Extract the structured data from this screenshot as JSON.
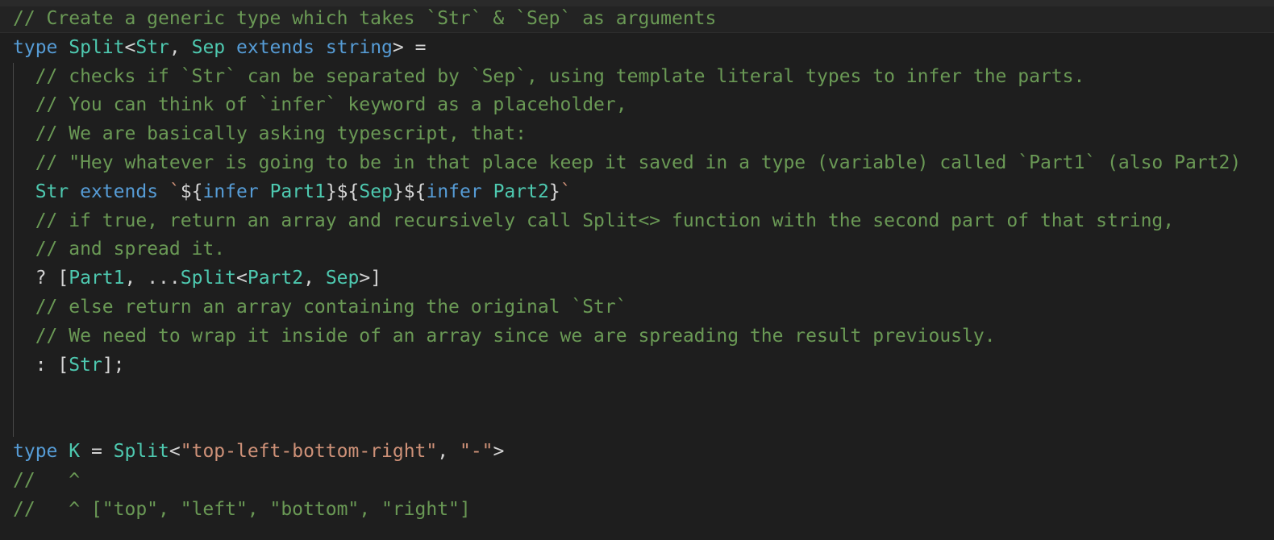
{
  "editor": {
    "language": "typescript",
    "theme": {
      "background": "#1e1e1e",
      "comment": "#6a9955",
      "keyword": "#569cd6",
      "type": "#4ec9b0",
      "string": "#ce9178",
      "text": "#d4d4d4"
    },
    "lines": [
      [
        {
          "t": "// Create a generic type which takes `Str` & `Sep` as arguments",
          "k": "c"
        }
      ],
      [
        {
          "t": "type",
          "k": "kw"
        },
        {
          "t": " ",
          "k": "pn"
        },
        {
          "t": "Split",
          "k": "ty"
        },
        {
          "t": "<",
          "k": "pn"
        },
        {
          "t": "Str",
          "k": "ty"
        },
        {
          "t": ", ",
          "k": "pn"
        },
        {
          "t": "Sep",
          "k": "ty"
        },
        {
          "t": " ",
          "k": "pn"
        },
        {
          "t": "extends",
          "k": "kw"
        },
        {
          "t": " ",
          "k": "pn"
        },
        {
          "t": "string",
          "k": "kw"
        },
        {
          "t": "> =",
          "k": "pn"
        }
      ],
      [
        {
          "t": "  // checks if `Str` can be separated by `Sep`, using template literal types to infer the parts.",
          "k": "c"
        }
      ],
      [
        {
          "t": "  // You can think of `infer` keyword as a placeholder,",
          "k": "c"
        }
      ],
      [
        {
          "t": "  // We are basically asking typescript, that:",
          "k": "c"
        }
      ],
      [
        {
          "t": "  // \"Hey whatever is going to be in that place keep it saved in a type (variable) called `Part1` (also Part2)",
          "k": "c"
        }
      ],
      [
        {
          "t": "  ",
          "k": "pn"
        },
        {
          "t": "Str",
          "k": "ty"
        },
        {
          "t": " ",
          "k": "pn"
        },
        {
          "t": "extends",
          "k": "kw"
        },
        {
          "t": " ",
          "k": "pn"
        },
        {
          "t": "`",
          "k": "tick"
        },
        {
          "t": "${",
          "k": "pn"
        },
        {
          "t": "infer",
          "k": "kw"
        },
        {
          "t": " ",
          "k": "pn"
        },
        {
          "t": "Part1",
          "k": "ty"
        },
        {
          "t": "}${",
          "k": "pn"
        },
        {
          "t": "Sep",
          "k": "ty"
        },
        {
          "t": "}${",
          "k": "pn"
        },
        {
          "t": "infer",
          "k": "kw"
        },
        {
          "t": " ",
          "k": "pn"
        },
        {
          "t": "Part2",
          "k": "ty"
        },
        {
          "t": "}",
          "k": "pn"
        },
        {
          "t": "`",
          "k": "tick"
        }
      ],
      [
        {
          "t": "  // if true, return an array and recursively call Split<> function with the second part of that string,",
          "k": "c"
        }
      ],
      [
        {
          "t": "  // and spread it.",
          "k": "c"
        }
      ],
      [
        {
          "t": "  ? [",
          "k": "pn"
        },
        {
          "t": "Part1",
          "k": "ty"
        },
        {
          "t": ", ...",
          "k": "pn"
        },
        {
          "t": "Split",
          "k": "ty"
        },
        {
          "t": "<",
          "k": "pn"
        },
        {
          "t": "Part2",
          "k": "ty"
        },
        {
          "t": ", ",
          "k": "pn"
        },
        {
          "t": "Sep",
          "k": "ty"
        },
        {
          "t": ">]",
          "k": "pn"
        }
      ],
      [
        {
          "t": "  // else return an array containing the original `Str`",
          "k": "c"
        }
      ],
      [
        {
          "t": "  // We need to wrap it inside of an array since we are spreading the result previously.",
          "k": "c"
        }
      ],
      [
        {
          "t": "  : [",
          "k": "pn"
        },
        {
          "t": "Str",
          "k": "ty"
        },
        {
          "t": "];",
          "k": "pn"
        }
      ],
      [
        {
          "t": "",
          "k": "pn"
        }
      ],
      [
        {
          "t": "",
          "k": "pn"
        }
      ],
      [
        {
          "t": "type",
          "k": "kw"
        },
        {
          "t": " ",
          "k": "pn"
        },
        {
          "t": "K",
          "k": "ty"
        },
        {
          "t": " = ",
          "k": "pn"
        },
        {
          "t": "Split",
          "k": "ty"
        },
        {
          "t": "<",
          "k": "pn"
        },
        {
          "t": "\"top-left-bottom-right\"",
          "k": "str"
        },
        {
          "t": ", ",
          "k": "pn"
        },
        {
          "t": "\"-\"",
          "k": "str"
        },
        {
          "t": ">",
          "k": "pn"
        }
      ],
      [
        {
          "t": "//   ^",
          "k": "c"
        }
      ],
      [
        {
          "t": "//   ^ [\"top\", \"left\", \"bottom\", \"right\"]",
          "k": "c"
        }
      ]
    ]
  }
}
